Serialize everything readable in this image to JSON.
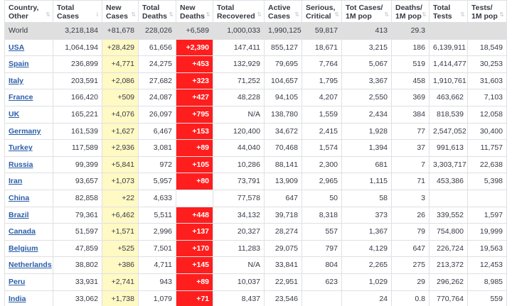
{
  "headers": [
    {
      "label": "Country, Other"
    },
    {
      "label": "Total Cases"
    },
    {
      "label": "New Cases"
    },
    {
      "label": "Total Deaths"
    },
    {
      "label": "New Deaths"
    },
    {
      "label": "Total Recovered"
    },
    {
      "label": "Active Cases"
    },
    {
      "label": "Serious, Critical"
    },
    {
      "label": "Tot Cases/ 1M pop"
    },
    {
      "label": "Deaths/ 1M pop"
    },
    {
      "label": "Total Tests"
    },
    {
      "label": "Tests/ 1M pop"
    }
  ],
  "sort_glyph": "⇅",
  "sort_active_glyph": "⇂",
  "colors": {
    "new_cases_bg": "#fff9c4",
    "new_deaths_bg": "#ff1e1e",
    "world_row_bg": "#dfdfdf",
    "country_link": "#2a5ea8"
  },
  "world": [
    "World",
    "3,218,184",
    "+81,678",
    "228,026",
    "+6,589",
    "1,000,033",
    "1,990,125",
    "59,817",
    "413",
    "29.3",
    "",
    ""
  ],
  "rows": [
    [
      "USA",
      "1,064,194",
      "+28,429",
      "61,656",
      "+2,390",
      "147,411",
      "855,127",
      "18,671",
      "3,215",
      "186",
      "6,139,911",
      "18,549"
    ],
    [
      "Spain",
      "236,899",
      "+4,771",
      "24,275",
      "+453",
      "132,929",
      "79,695",
      "7,764",
      "5,067",
      "519",
      "1,414,477",
      "30,253"
    ],
    [
      "Italy",
      "203,591",
      "+2,086",
      "27,682",
      "+323",
      "71,252",
      "104,657",
      "1,795",
      "3,367",
      "458",
      "1,910,761",
      "31,603"
    ],
    [
      "France",
      "166,420",
      "+509",
      "24,087",
      "+427",
      "48,228",
      "94,105",
      "4,207",
      "2,550",
      "369",
      "463,662",
      "7,103"
    ],
    [
      "UK",
      "165,221",
      "+4,076",
      "26,097",
      "+795",
      "N/A",
      "138,780",
      "1,559",
      "2,434",
      "384",
      "818,539",
      "12,058"
    ],
    [
      "Germany",
      "161,539",
      "+1,627",
      "6,467",
      "+153",
      "120,400",
      "34,672",
      "2,415",
      "1,928",
      "77",
      "2,547,052",
      "30,400"
    ],
    [
      "Turkey",
      "117,589",
      "+2,936",
      "3,081",
      "+89",
      "44,040",
      "70,468",
      "1,574",
      "1,394",
      "37",
      "991,613",
      "11,757"
    ],
    [
      "Russia",
      "99,399",
      "+5,841",
      "972",
      "+105",
      "10,286",
      "88,141",
      "2,300",
      "681",
      "7",
      "3,303,717",
      "22,638"
    ],
    [
      "Iran",
      "93,657",
      "+1,073",
      "5,957",
      "+80",
      "73,791",
      "13,909",
      "2,965",
      "1,115",
      "71",
      "453,386",
      "5,398"
    ],
    [
      "China",
      "82,858",
      "+22",
      "4,633",
      "",
      "77,578",
      "647",
      "50",
      "58",
      "3",
      "",
      ""
    ],
    [
      "Brazil",
      "79,361",
      "+6,462",
      "5,511",
      "+448",
      "34,132",
      "39,718",
      "8,318",
      "373",
      "26",
      "339,552",
      "1,597"
    ],
    [
      "Canada",
      "51,597",
      "+1,571",
      "2,996",
      "+137",
      "20,327",
      "28,274",
      "557",
      "1,367",
      "79",
      "754,800",
      "19,999"
    ],
    [
      "Belgium",
      "47,859",
      "+525",
      "7,501",
      "+170",
      "11,283",
      "29,075",
      "797",
      "4,129",
      "647",
      "226,724",
      "19,563"
    ],
    [
      "Netherlands",
      "38,802",
      "+386",
      "4,711",
      "+145",
      "N/A",
      "33,841",
      "804",
      "2,265",
      "275",
      "213,372",
      "12,453"
    ],
    [
      "Peru",
      "33,931",
      "+2,741",
      "943",
      "+89",
      "10,037",
      "22,951",
      "623",
      "1,029",
      "29",
      "296,262",
      "8,985"
    ],
    [
      "India",
      "33,062",
      "+1,738",
      "1,079",
      "+71",
      "8,437",
      "23,546",
      "",
      "24",
      "0.8",
      "770,764",
      "559"
    ]
  ]
}
